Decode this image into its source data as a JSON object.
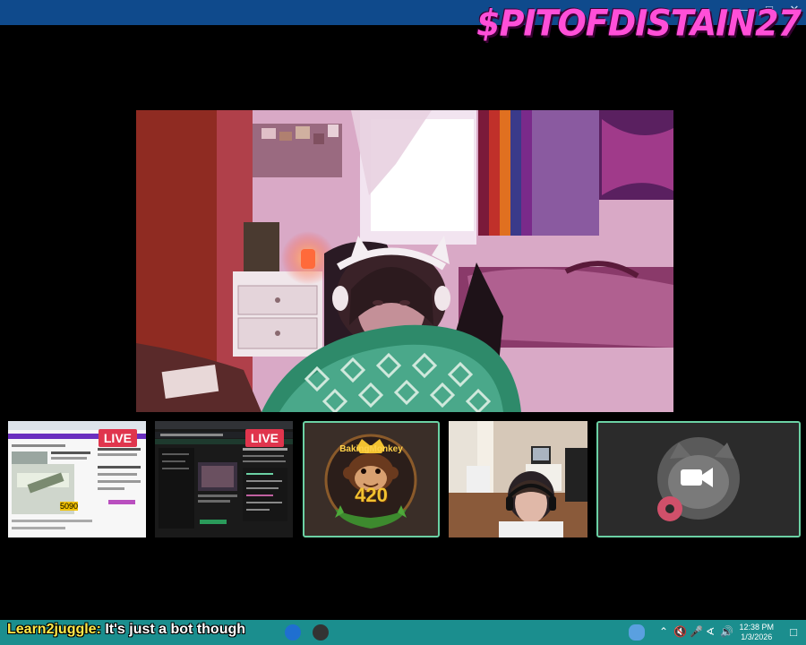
{
  "overlay": {
    "streamer_name": "$PITOFDISTAIN27"
  },
  "tiles": [
    {
      "name": "screen-share-1",
      "live_label": "LIVE",
      "screen_tally": "5090"
    },
    {
      "name": "screen-share-2",
      "live_label": "LIVE"
    },
    {
      "name": "bakingmonkey",
      "logo_top": "BakingMonkey",
      "logo_num": "420"
    },
    {
      "name": "webcam-guest"
    },
    {
      "name": "camera-off"
    }
  ],
  "chat": {
    "user": "Learn2juggle:",
    "message": " It's just a bot though"
  },
  "taskbar": {
    "time": "12:38 PM",
    "date": "1/3/2026"
  },
  "colors": {
    "accent_name": "#ff4fd8",
    "tile_border": "#6bd1a4",
    "live_badge": "#e0354d",
    "taskbar": "#1b8e8e"
  }
}
